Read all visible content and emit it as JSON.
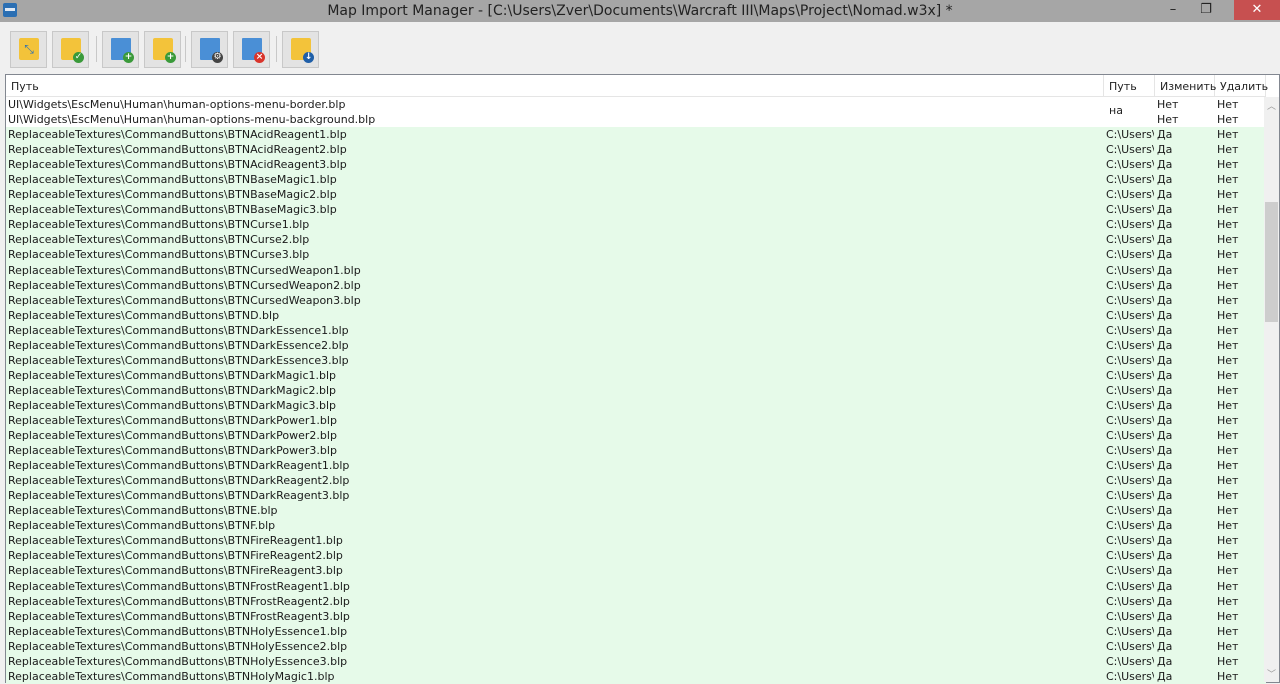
{
  "window": {
    "title": "Map Import Manager - [C:\\Users\\Zver\\Documents\\Warcraft III\\Maps\\Project\\Nomad.w3x] *",
    "minimize": "–",
    "restore": "❐",
    "close": "✕"
  },
  "toolbar": [
    {
      "name": "import-folder-button",
      "icon": "folder-arrows-icon"
    },
    {
      "name": "import-folder-confirm-button",
      "icon": "folder-check-icon"
    },
    {
      "name": "add-file-button",
      "icon": "file-add-icon"
    },
    {
      "name": "add-folder-button",
      "icon": "folder-add-icon"
    },
    {
      "name": "file-properties-button",
      "icon": "file-gear-icon"
    },
    {
      "name": "remove-file-button",
      "icon": "file-remove-icon"
    },
    {
      "name": "export-button",
      "icon": "folder-download-icon"
    }
  ],
  "columns": [
    "Путь",
    "Путь на",
    "Изменить",
    "Удалить"
  ],
  "colors": {
    "new_row": "#e6fae9"
  },
  "rows": [
    [
      "UI\\Widgets\\EscMenu\\Human\\human-options-menu-border.blp",
      "",
      "Нет",
      "Нет"
    ],
    [
      "UI\\Widgets\\EscMenu\\Human\\human-options-menu-background.blp",
      "",
      "Нет",
      "Нет"
    ],
    [
      "ReplaceableTextures\\CommandButtons\\BTNAcidReagent1.blp",
      "C:\\Users\\Z",
      "Да",
      "Нет"
    ],
    [
      "ReplaceableTextures\\CommandButtons\\BTNAcidReagent2.blp",
      "C:\\Users\\Z",
      "Да",
      "Нет"
    ],
    [
      "ReplaceableTextures\\CommandButtons\\BTNAcidReagent3.blp",
      "C:\\Users\\Z",
      "Да",
      "Нет"
    ],
    [
      "ReplaceableTextures\\CommandButtons\\BTNBaseMagic1.blp",
      "C:\\Users\\Z",
      "Да",
      "Нет"
    ],
    [
      "ReplaceableTextures\\CommandButtons\\BTNBaseMagic2.blp",
      "C:\\Users\\Z",
      "Да",
      "Нет"
    ],
    [
      "ReplaceableTextures\\CommandButtons\\BTNBaseMagic3.blp",
      "C:\\Users\\Z",
      "Да",
      "Нет"
    ],
    [
      "ReplaceableTextures\\CommandButtons\\BTNCurse1.blp",
      "C:\\Users\\Z",
      "Да",
      "Нет"
    ],
    [
      "ReplaceableTextures\\CommandButtons\\BTNCurse2.blp",
      "C:\\Users\\Z",
      "Да",
      "Нет"
    ],
    [
      "ReplaceableTextures\\CommandButtons\\BTNCurse3.blp",
      "C:\\Users\\Z",
      "Да",
      "Нет"
    ],
    [
      "ReplaceableTextures\\CommandButtons\\BTNCursedWeapon1.blp",
      "C:\\Users\\Z",
      "Да",
      "Нет"
    ],
    [
      "ReplaceableTextures\\CommandButtons\\BTNCursedWeapon2.blp",
      "C:\\Users\\Z",
      "Да",
      "Нет"
    ],
    [
      "ReplaceableTextures\\CommandButtons\\BTNCursedWeapon3.blp",
      "C:\\Users\\Z",
      "Да",
      "Нет"
    ],
    [
      "ReplaceableTextures\\CommandButtons\\BTND.blp",
      "C:\\Users\\Z",
      "Да",
      "Нет"
    ],
    [
      "ReplaceableTextures\\CommandButtons\\BTNDarkEssence1.blp",
      "C:\\Users\\Z",
      "Да",
      "Нет"
    ],
    [
      "ReplaceableTextures\\CommandButtons\\BTNDarkEssence2.blp",
      "C:\\Users\\Z",
      "Да",
      "Нет"
    ],
    [
      "ReplaceableTextures\\CommandButtons\\BTNDarkEssence3.blp",
      "C:\\Users\\Z",
      "Да",
      "Нет"
    ],
    [
      "ReplaceableTextures\\CommandButtons\\BTNDarkMagic1.blp",
      "C:\\Users\\Z",
      "Да",
      "Нет"
    ],
    [
      "ReplaceableTextures\\CommandButtons\\BTNDarkMagic2.blp",
      "C:\\Users\\Z",
      "Да",
      "Нет"
    ],
    [
      "ReplaceableTextures\\CommandButtons\\BTNDarkMagic3.blp",
      "C:\\Users\\Z",
      "Да",
      "Нет"
    ],
    [
      "ReplaceableTextures\\CommandButtons\\BTNDarkPower1.blp",
      "C:\\Users\\Z",
      "Да",
      "Нет"
    ],
    [
      "ReplaceableTextures\\CommandButtons\\BTNDarkPower2.blp",
      "C:\\Users\\Z",
      "Да",
      "Нет"
    ],
    [
      "ReplaceableTextures\\CommandButtons\\BTNDarkPower3.blp",
      "C:\\Users\\Z",
      "Да",
      "Нет"
    ],
    [
      "ReplaceableTextures\\CommandButtons\\BTNDarkReagent1.blp",
      "C:\\Users\\Z",
      "Да",
      "Нет"
    ],
    [
      "ReplaceableTextures\\CommandButtons\\BTNDarkReagent2.blp",
      "C:\\Users\\Z",
      "Да",
      "Нет"
    ],
    [
      "ReplaceableTextures\\CommandButtons\\BTNDarkReagent3.blp",
      "C:\\Users\\Z",
      "Да",
      "Нет"
    ],
    [
      "ReplaceableTextures\\CommandButtons\\BTNE.blp",
      "C:\\Users\\Z",
      "Да",
      "Нет"
    ],
    [
      "ReplaceableTextures\\CommandButtons\\BTNF.blp",
      "C:\\Users\\Z",
      "Да",
      "Нет"
    ],
    [
      "ReplaceableTextures\\CommandButtons\\BTNFireReagent1.blp",
      "C:\\Users\\Z",
      "Да",
      "Нет"
    ],
    [
      "ReplaceableTextures\\CommandButtons\\BTNFireReagent2.blp",
      "C:\\Users\\Z",
      "Да",
      "Нет"
    ],
    [
      "ReplaceableTextures\\CommandButtons\\BTNFireReagent3.blp",
      "C:\\Users\\Z",
      "Да",
      "Нет"
    ],
    [
      "ReplaceableTextures\\CommandButtons\\BTNFrostReagent1.blp",
      "C:\\Users\\Z",
      "Да",
      "Нет"
    ],
    [
      "ReplaceableTextures\\CommandButtons\\BTNFrostReagent2.blp",
      "C:\\Users\\Z",
      "Да",
      "Нет"
    ],
    [
      "ReplaceableTextures\\CommandButtons\\BTNFrostReagent3.blp",
      "C:\\Users\\Z",
      "Да",
      "Нет"
    ],
    [
      "ReplaceableTextures\\CommandButtons\\BTNHolyEssence1.blp",
      "C:\\Users\\Z",
      "Да",
      "Нет"
    ],
    [
      "ReplaceableTextures\\CommandButtons\\BTNHolyEssence2.blp",
      "C:\\Users\\Z",
      "Да",
      "Нет"
    ],
    [
      "ReplaceableTextures\\CommandButtons\\BTNHolyEssence3.blp",
      "C:\\Users\\Z",
      "Да",
      "Нет"
    ],
    [
      "ReplaceableTextures\\CommandButtons\\BTNHolyMagic1.blp",
      "C:\\Users\\Z",
      "Да",
      "Нет"
    ]
  ]
}
